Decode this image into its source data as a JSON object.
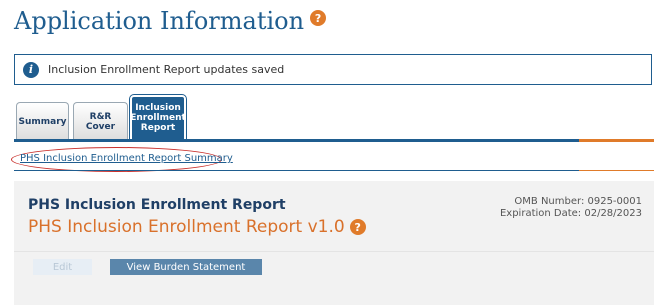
{
  "header": {
    "title": "Application Information",
    "help_icon": "?"
  },
  "alert": {
    "icon": "i",
    "message": "Inclusion Enrollment Report updates saved"
  },
  "tabs": [
    {
      "label": "Summary",
      "active": false
    },
    {
      "label": "R&R Cover",
      "active": false
    },
    {
      "label": "Inclusion Enrollment Report",
      "active": true
    }
  ],
  "summary_link": "PHS Inclusion Enrollment Report Summary",
  "panel": {
    "title": "PHS Inclusion Enrollment Report",
    "subtitle": "PHS Inclusion Enrollment Report v1.0",
    "help_icon": "?",
    "omb_number": "OMB Number: 0925-0001",
    "expiration": "Expiration Date: 02/28/2023"
  },
  "buttons": {
    "edit": "Edit",
    "burden": "View Burden Statement"
  },
  "colors": {
    "brand_blue": "#1f5d8f",
    "accent_orange": "#e07b2a",
    "highlight_red": "#c9302c"
  }
}
